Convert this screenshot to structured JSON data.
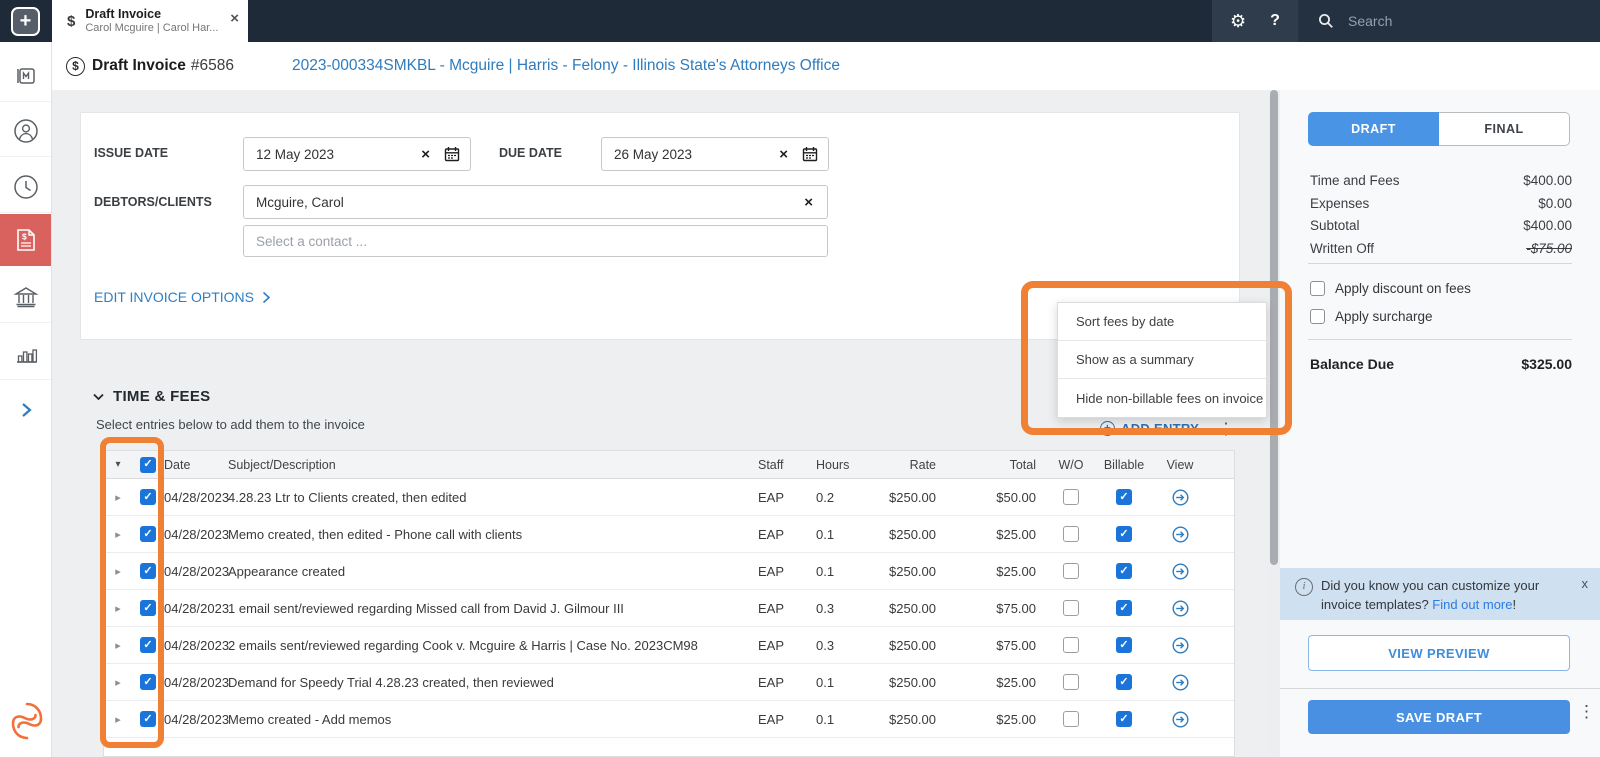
{
  "topbar": {
    "add_button_glyph": "+",
    "tab": {
      "icon_glyph": "$",
      "title": "Draft Invoice",
      "subtitle": "Carol Mcguire | Carol Har...",
      "close_glyph": "×"
    },
    "gear_glyph": "⚙",
    "help_glyph": "?",
    "search": {
      "placeholder": "Search"
    }
  },
  "sidebar": {
    "items": [
      {
        "name": "matters",
        "active": false
      },
      {
        "name": "contacts",
        "active": false
      },
      {
        "name": "time-entries",
        "active": false
      },
      {
        "name": "billing",
        "active": true
      },
      {
        "name": "trust-accounts",
        "active": false
      },
      {
        "name": "reports",
        "active": false
      },
      {
        "name": "expand",
        "active": false
      }
    ],
    "logo": "smokeball"
  },
  "header": {
    "title": "Draft Invoice",
    "invoice_number": "#6586",
    "matter_link": "2023-000334SMKBL - Mcguire | Harris - Felony - Illinois State's Attorneys Office"
  },
  "form": {
    "issue_date": {
      "label": "ISSUE DATE",
      "value": "12 May 2023"
    },
    "due_date": {
      "label": "DUE DATE",
      "value": "26 May 2023"
    },
    "debtors": {
      "label": "DEBTORS/CLIENTS",
      "value": "Mcguire, Carol"
    },
    "contact_placeholder": "Select a contact ...",
    "edit_options_label": "EDIT INVOICE OPTIONS"
  },
  "options_menu": {
    "items": [
      "Sort fees by date",
      "Show as a summary",
      "Hide non-billable fees on invoice"
    ]
  },
  "time_fees": {
    "title": "TIME & FEES",
    "subtitle": "Select entries below to add them to the invoice",
    "add_entry_label": "ADD ENTRY",
    "kebab_glyph": "⋮",
    "table": {
      "select_all_checked": true,
      "columns": [
        "Date",
        "Subject/Description",
        "Staff",
        "Hours",
        "Rate",
        "Total",
        "W/O",
        "Billable",
        "View"
      ],
      "rows": [
        {
          "date": "04/28/2023",
          "description": "4.28.23 Ltr to Clients created, then edited",
          "staff": "EAP",
          "hours": "0.2",
          "rate": "$250.00",
          "total": "$50.00",
          "selected": true,
          "wo": false,
          "billable": true
        },
        {
          "date": "04/28/2023",
          "description": "Memo created, then edited - Phone call with clients",
          "staff": "EAP",
          "hours": "0.1",
          "rate": "$250.00",
          "total": "$25.00",
          "selected": true,
          "wo": false,
          "billable": true
        },
        {
          "date": "04/28/2023",
          "description": "Appearance created",
          "staff": "EAP",
          "hours": "0.1",
          "rate": "$250.00",
          "total": "$25.00",
          "selected": true,
          "wo": false,
          "billable": true
        },
        {
          "date": "04/28/2023",
          "description": "1 email sent/reviewed regarding Missed call from David J. Gilmour III",
          "staff": "EAP",
          "hours": "0.3",
          "rate": "$250.00",
          "total": "$75.00",
          "selected": true,
          "wo": false,
          "billable": true
        },
        {
          "date": "04/28/2023",
          "description": "2 emails sent/reviewed regarding Cook v. Mcguire & Harris | Case No. 2023CM98",
          "staff": "EAP",
          "hours": "0.3",
          "rate": "$250.00",
          "total": "$75.00",
          "selected": true,
          "wo": false,
          "billable": true
        },
        {
          "date": "04/28/2023",
          "description": "Demand for Speedy Trial 4.28.23 created, then reviewed",
          "staff": "EAP",
          "hours": "0.1",
          "rate": "$250.00",
          "total": "$25.00",
          "selected": true,
          "wo": false,
          "billable": true
        },
        {
          "date": "04/28/2023",
          "description": "Memo created - Add memos",
          "staff": "EAP",
          "hours": "0.1",
          "rate": "$250.00",
          "total": "$25.00",
          "selected": true,
          "wo": false,
          "billable": true
        }
      ]
    }
  },
  "summary": {
    "tabs": {
      "draft": "DRAFT",
      "final": "FINAL",
      "selected": "DRAFT"
    },
    "lines": [
      {
        "label": "Time and Fees",
        "value": "$400.00"
      },
      {
        "label": "Expenses",
        "value": "$0.00"
      },
      {
        "label": "Subtotal",
        "value": "$400.00"
      },
      {
        "label": "Written Off",
        "value": "-$75.00",
        "struck": true
      }
    ],
    "checkboxes": [
      {
        "label": "Apply discount on fees",
        "checked": false
      },
      {
        "label": "Apply surcharge",
        "checked": false
      }
    ],
    "balance": {
      "label": "Balance Due",
      "value": "$325.00"
    },
    "tip": {
      "text": "Did you know you can customize your invoice templates? ",
      "link": "Find out more",
      "suffix": "!",
      "close_glyph": "x"
    },
    "view_preview_label": "VIEW PREVIEW",
    "save_draft_label": "SAVE DRAFT"
  },
  "colors": {
    "topbar": "#1e2a37",
    "accent_blue": "#2e7cbe",
    "checkbox_blue": "#1b74d9",
    "button_blue": "#4a90e2",
    "sidebar_active_red": "#da625e",
    "annotation_orange": "#ef8034",
    "banner_blue": "#cfe0f1"
  }
}
